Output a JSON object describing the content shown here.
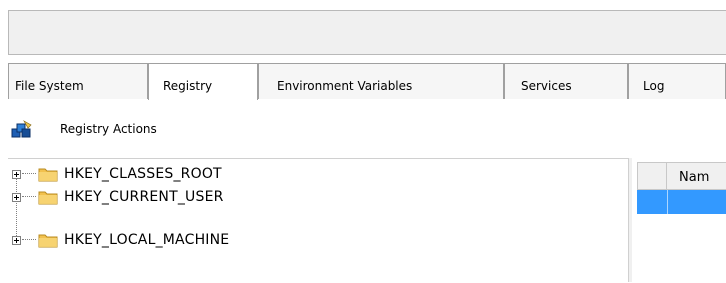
{
  "tabs": [
    {
      "label": "File System",
      "active": false
    },
    {
      "label": "Registry",
      "active": true
    },
    {
      "label": "Environment Variables",
      "active": false
    },
    {
      "label": "Services",
      "active": false
    },
    {
      "label": "Log",
      "active": false
    }
  ],
  "toolbar": {
    "actions_label": "Registry Actions",
    "icon": "registry-actions-icon"
  },
  "tree": {
    "items": [
      {
        "label": "HKEY_CLASSES_ROOT",
        "icon": "folder-icon"
      },
      {
        "label": "HKEY_CURRENT_USER",
        "icon": "folder-icon"
      },
      {
        "label": "HKEY_LOCAL_MACHINE",
        "icon": "folder-icon"
      }
    ]
  },
  "grid": {
    "column_header": "Nam"
  },
  "colors": {
    "selection": "#3399ff",
    "chrome": "#f0f0f0",
    "border": "#a0a0a0"
  }
}
